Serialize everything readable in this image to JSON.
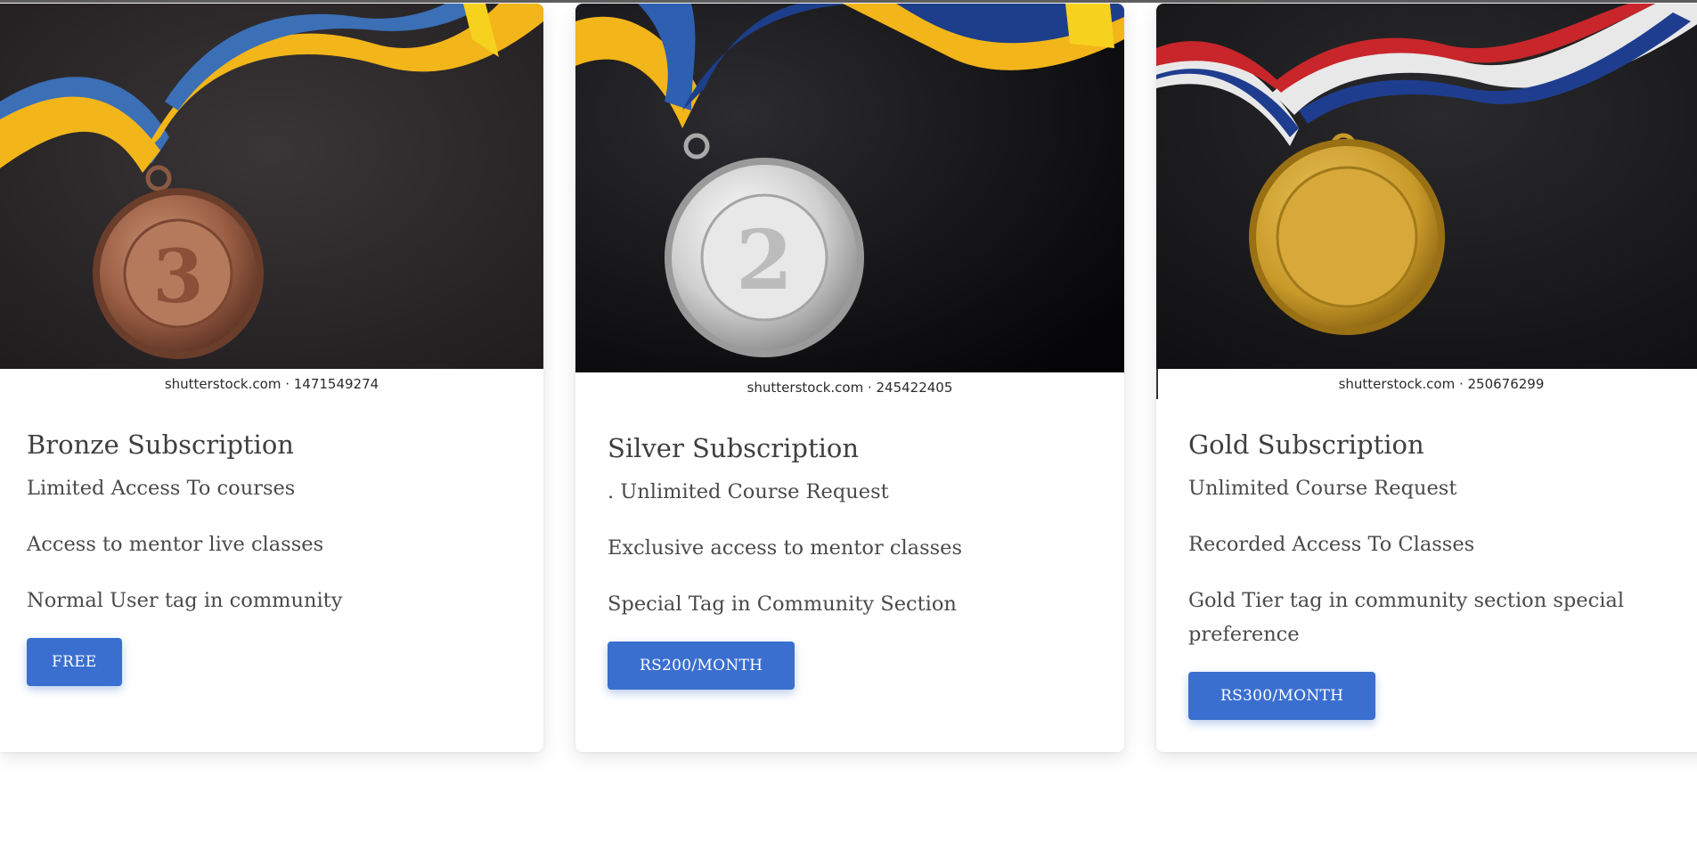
{
  "cards": [
    {
      "id": "bronze",
      "image": {
        "medal": "bronze-medal-3",
        "number": "3",
        "credit": "shutterstock.com · 1471549274"
      },
      "title": "Bronze Subscription",
      "features": [
        "Limited Access To courses",
        "Access to mentor live classes",
        "Normal User tag in community"
      ],
      "button": "FREE"
    },
    {
      "id": "silver",
      "image": {
        "medal": "silver-medal-2",
        "number": "2",
        "credit": "shutterstock.com · 245422405"
      },
      "title": "Silver Subscription",
      "features": [
        ". Unlimited Course Request",
        "Exclusive access to mentor classes",
        "Special Tag in Community Section"
      ],
      "button": "RS200/MONTH"
    },
    {
      "id": "gold",
      "image": {
        "medal": "gold-medal",
        "number": "",
        "credit": "shutterstock.com · 250676299"
      },
      "title": "Gold Subscription",
      "features": [
        "Unlimited Course Request",
        "Recorded Access To Classes",
        "Gold Tier tag in community section special preference"
      ],
      "button": "RS300/MONTH"
    }
  ],
  "colors": {
    "button": "#3a6fcf",
    "text": "#4a4a4a",
    "bronze": "#a0674a",
    "silver": "#d9d9d9",
    "gold": "#d4a52b"
  }
}
